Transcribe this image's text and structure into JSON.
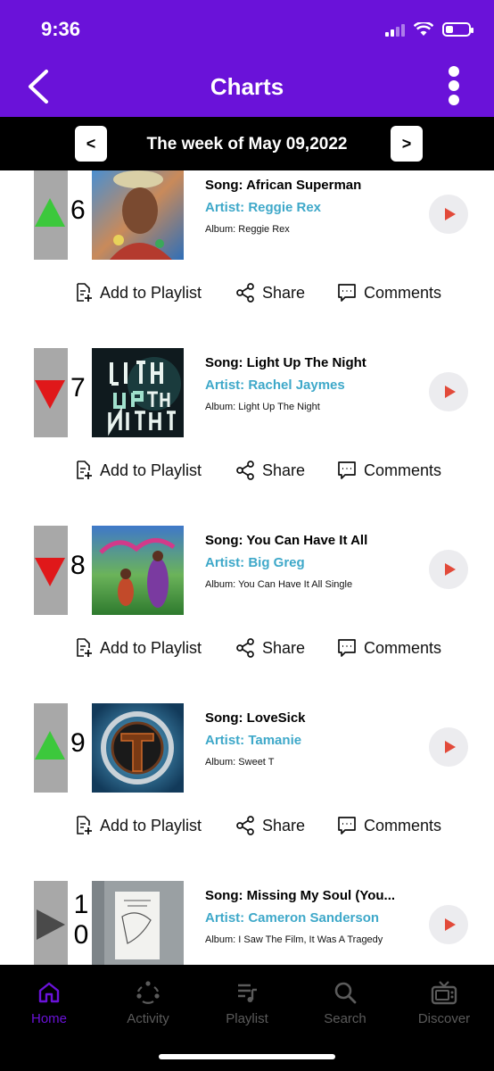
{
  "status": {
    "time": "9:36"
  },
  "header": {
    "title": "Charts"
  },
  "week": {
    "label": "The week of May 09,2022",
    "prev": "<",
    "next": ">"
  },
  "colors": {
    "accent": "#6a12d9",
    "artist": "#3ea8c9",
    "up": "#3cc83c",
    "down": "#e0181a",
    "same": "#4a4a4a"
  },
  "items": [
    {
      "rank": "6",
      "trend": "up",
      "song": "Song: African Superman",
      "artist": "Artist: Reggie Rex",
      "album": "Album: Reggie Rex"
    },
    {
      "rank": "7",
      "trend": "down",
      "song": "Song: Light Up The Night",
      "artist": "Artist: Rachel Jaymes",
      "album": "Album: Light Up The Night"
    },
    {
      "rank": "8",
      "trend": "down",
      "song": "Song: You Can Have It All",
      "artist": "Artist: Big Greg",
      "album": "Album: You Can Have It All Single"
    },
    {
      "rank": "9",
      "trend": "up",
      "song": "Song: LoveSick",
      "artist": "Artist: Tamanie",
      "album": "Album: Sweet T"
    },
    {
      "rank": "10",
      "trend": "same",
      "song": "Song: Missing My Soul (You...",
      "artist": "Artist: Cameron Sanderson",
      "album": "Album: I Saw The Film, It Was A Tragedy"
    }
  ],
  "actions": {
    "add": "Add to Playlist",
    "share": "Share",
    "comments": "Comments"
  },
  "nav": {
    "home": "Home",
    "activity": "Activity",
    "playlist": "Playlist",
    "search": "Search",
    "discover": "Discover"
  }
}
